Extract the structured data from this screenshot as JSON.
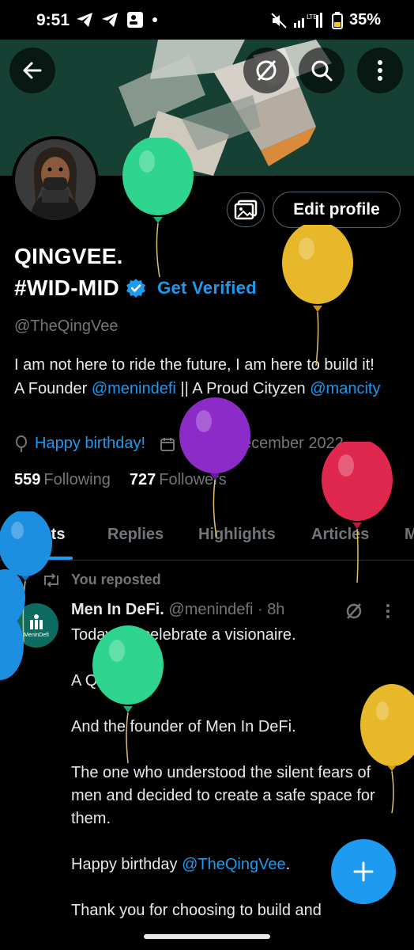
{
  "status_bar": {
    "time": "9:51",
    "battery": "35%",
    "network": "LTE"
  },
  "header": {
    "back_icon": "arrow-left-icon",
    "grok_icon": "grok-slash-icon",
    "search_icon": "search-icon",
    "more_icon": "more-vertical-icon"
  },
  "profile": {
    "name_line1": "QINGVEE.",
    "name_line2": "#WID-MID",
    "get_verified": "Get Verified",
    "handle": "@TheQingVee",
    "edit_profile": "Edit profile",
    "bio": {
      "part1": "I am not here to ride the future, I am here to build it! A Founder ",
      "link1": "@menindefi",
      "part2": " || A Proud Cityzen ",
      "link2": "@mancity"
    },
    "birthday": "Happy birthday!",
    "joined": "Joined December 2022",
    "following_count": "559",
    "following_label": "Following",
    "followers_count": "727",
    "followers_label": "Followers"
  },
  "tabs": [
    "Posts",
    "Replies",
    "Highlights",
    "Articles",
    "M"
  ],
  "post": {
    "reposted_label": "You reposted",
    "author_name": "Men In DeFi.",
    "author_handle": "@menindefi",
    "separator": "·",
    "time": "8h",
    "avatar_text": "MeninDefi",
    "paragraphs": {
      "p1": "Today we celebrate a visionaire.",
      "p2": "A QING.",
      "p3": "And the founder of Men In DeFi.",
      "p4": "The one who understood the silent fears of men and decided to create a safe space for them.",
      "p5_text": "Happy birthday ",
      "p5_link": "@TheQingVee",
      "p5_end": ".",
      "p6": "Thank you for choosing to build and"
    }
  },
  "colors": {
    "accent": "#1d9bf0",
    "background": "#000000",
    "muted": "#71767b",
    "balloon_green": "#2fd48f",
    "balloon_yellow": "#e6b82a",
    "balloon_purple": "#8d2bc9",
    "balloon_red": "#e0284f",
    "balloon_blue": "#1d8fe0"
  }
}
